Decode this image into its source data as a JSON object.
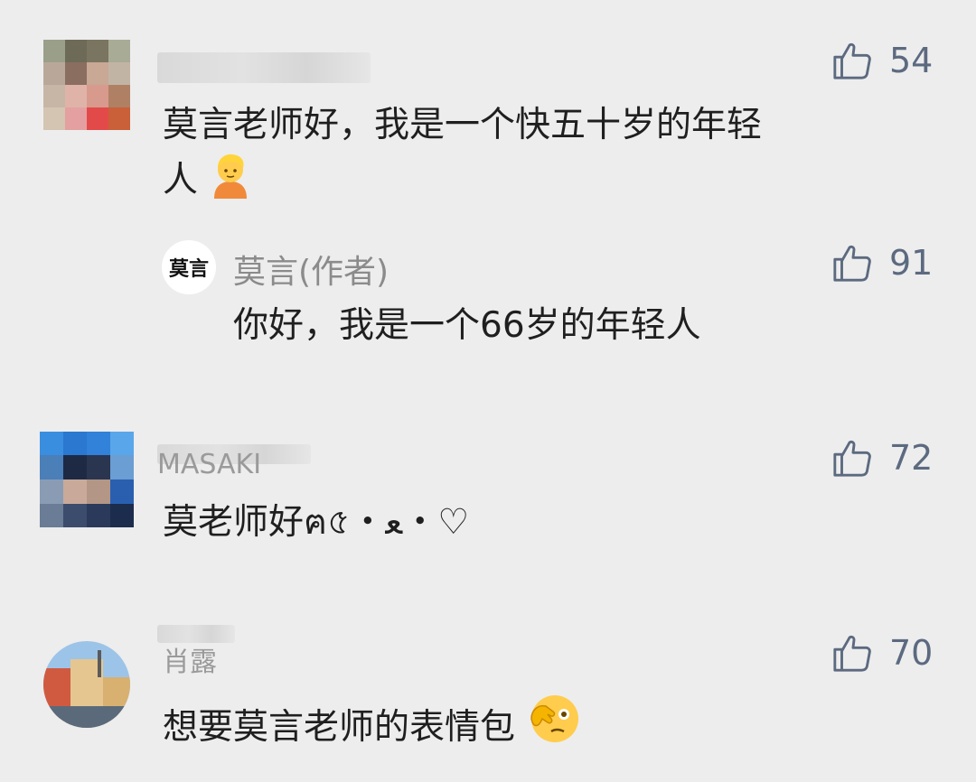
{
  "comments": [
    {
      "username": "",
      "text_line1": "莫言老师好，我是一个快五十岁的年轻",
      "text_line2": "人",
      "emoji": "person-emoji",
      "likes": "54"
    },
    {
      "username": "MASAKI",
      "text": "莫老师好ฅ৫・ﻌ・♡",
      "likes": "72"
    },
    {
      "username": "肖露",
      "text": "想要莫言老师的表情包",
      "emoji": "face-with-hand-over-eye-emoji",
      "likes": "70"
    }
  ],
  "reply": {
    "author_avatar_text": "莫言",
    "author_name": "莫言(作者)",
    "text": "你好，我是一个66岁的年轻人",
    "likes": "91"
  },
  "colors": {
    "background": "#ededed",
    "like_icon": "#5c6a80",
    "text": "#1f1f1f",
    "author_name": "#8b8b8b"
  }
}
